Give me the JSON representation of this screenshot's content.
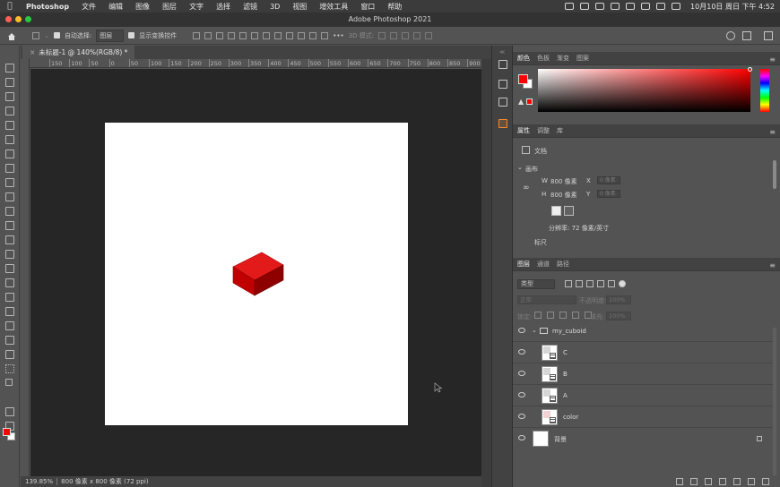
{
  "menubar": {
    "app": "Photoshop",
    "items": [
      "文件",
      "编辑",
      "图像",
      "图层",
      "文字",
      "选择",
      "滤镜",
      "3D",
      "视图",
      "增效工具",
      "窗口",
      "帮助"
    ],
    "clock": "10月10日 周日 下午 4:52"
  },
  "window": {
    "title": "Adobe Photoshop 2021"
  },
  "options": {
    "auto_select_label": "自动选择:",
    "auto_select_value": "图层",
    "show_transform_label": "显示变换控件",
    "mode_3d_label": "3D 模式:"
  },
  "document": {
    "tab_label": "未标题-1 @ 140%(RGB/8) *",
    "ruler_ticks": [
      "150",
      "100",
      "50",
      "0",
      "50",
      "100",
      "150",
      "200",
      "250",
      "300",
      "350",
      "400",
      "450",
      "500",
      "550",
      "600",
      "650",
      "700",
      "750",
      "800",
      "850",
      "900",
      "950"
    ],
    "zoom": "139.85%",
    "size_info": "800 像素 x 800 像素 (72 ppi)"
  },
  "color_panel": {
    "tabs": [
      "颜色",
      "色板",
      "渐变",
      "图案"
    ],
    "foreground": "#ff0000",
    "background": "#ffffff"
  },
  "properties_panel": {
    "tabs": [
      "属性",
      "调整",
      "库"
    ],
    "doc_label": "文档",
    "section_canvas": "画布",
    "w_label": "W",
    "w_value": "800 像素",
    "h_label": "H",
    "h_value": "800 像素",
    "x_label": "X",
    "y_label": "Y",
    "x_placeholder": "0 像素",
    "y_placeholder": "0 像素",
    "resolution": "分辨率: 72 像素/英寸",
    "section_more": "标尺"
  },
  "layers_panel": {
    "tabs": [
      "图层",
      "通道",
      "路径"
    ],
    "filter_value": "类型",
    "blend_mode": "正常",
    "opacity_label": "不透明度:",
    "opacity_value": "100%",
    "lock_label": "锁定:",
    "fill_label": "填充:",
    "fill_value": "100%",
    "layers": [
      {
        "name": "my_cuboid",
        "kind": "group"
      },
      {
        "name": "C",
        "kind": "smart"
      },
      {
        "name": "B",
        "kind": "smart"
      },
      {
        "name": "A",
        "kind": "smart"
      },
      {
        "name": "color",
        "kind": "smart"
      },
      {
        "name": "背景",
        "kind": "background"
      }
    ]
  },
  "accent_color": "#f28a2b"
}
